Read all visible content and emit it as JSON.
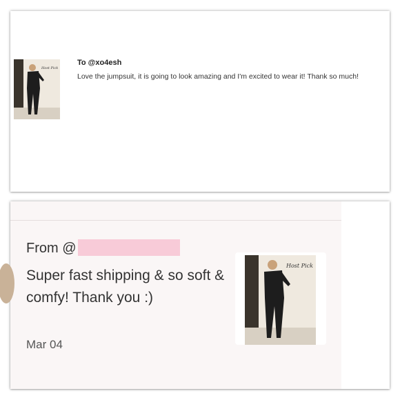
{
  "top_card": {
    "recipient": "To @xo4esh",
    "message": "Love the jumpsuit, it is going to look amazing and I'm excited to wear it! Thank so much!",
    "image_caption": "Host Pick"
  },
  "bottom_card": {
    "from_prefix": "From @",
    "review_text": "Super fast shipping & so soft & comfy! Thank you :)",
    "date": "Mar 04",
    "image_caption": "Host Pick",
    "redaction_color": "#f8cbd8"
  }
}
